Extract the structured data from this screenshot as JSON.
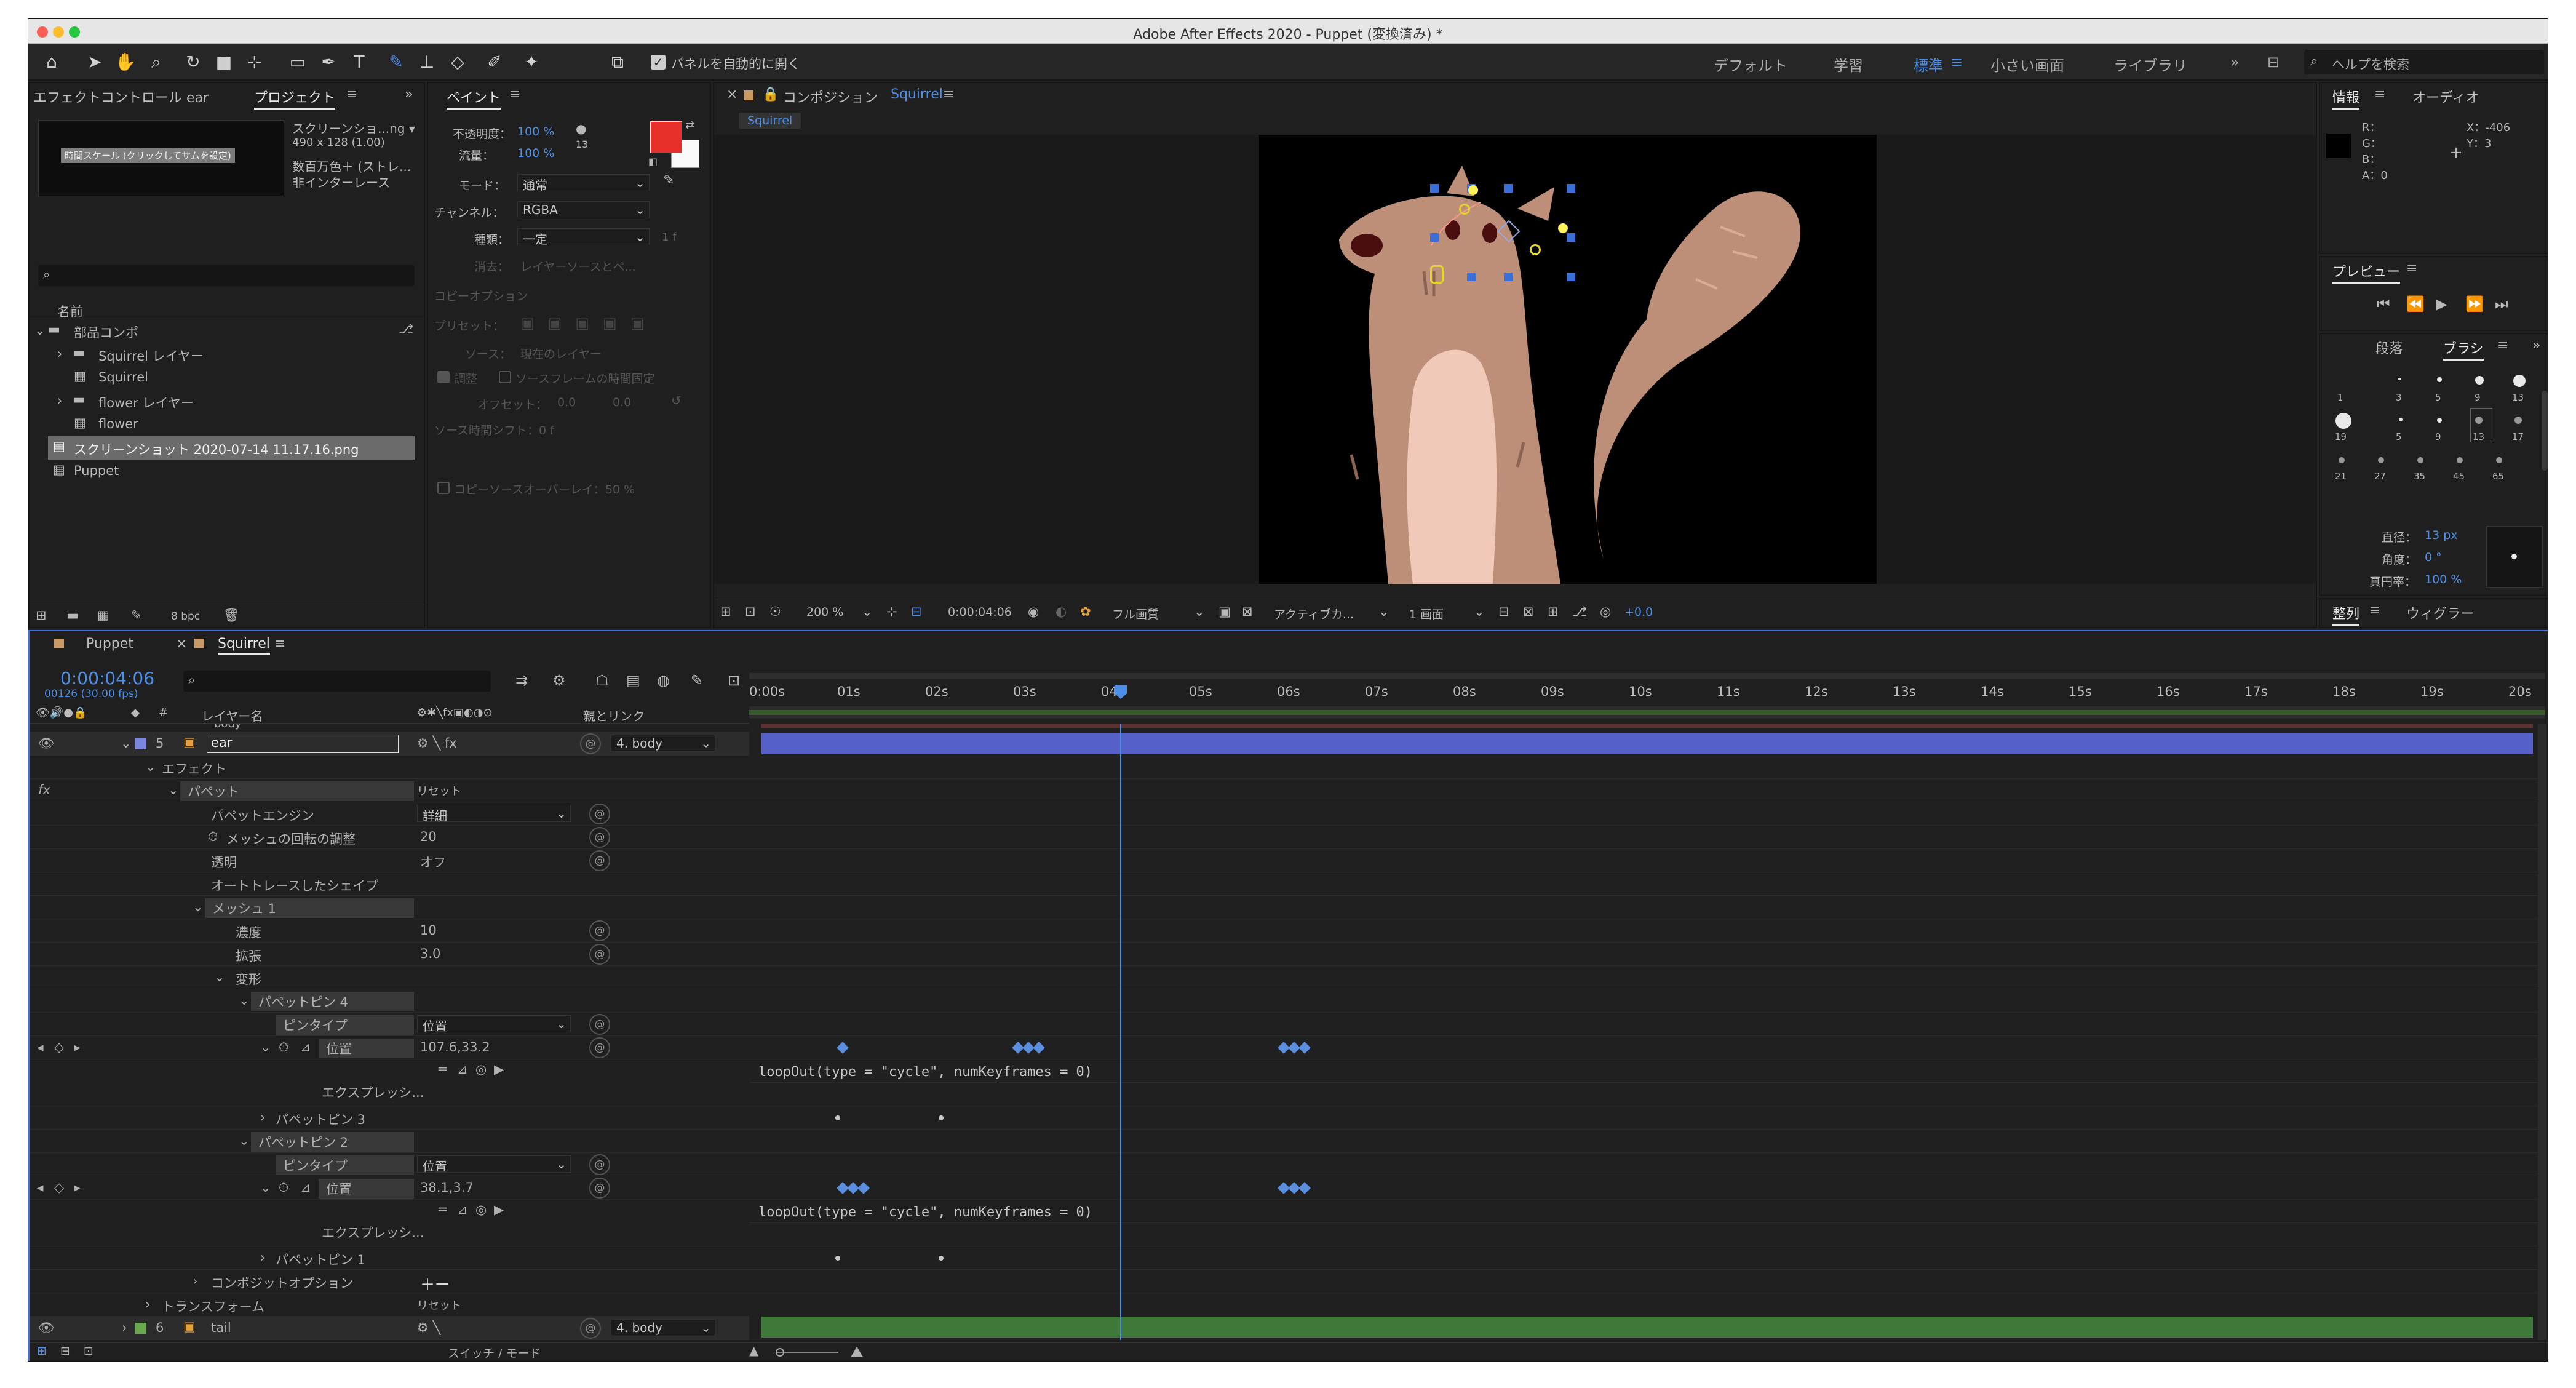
{
  "window": {
    "title": "Adobe After Effects 2020 - Puppet (変換済み) *"
  },
  "toolbar": {
    "auto_open": "パネルを自動的に開く",
    "ws_default": "デフォルト",
    "ws_learn": "学習",
    "ws_standard": "標準",
    "ws_small": "小さい画面",
    "ws_library": "ライブラリ",
    "search_placeholder": "ヘルプを検索",
    "more": "»"
  },
  "project": {
    "tab_effects": "エフェクトコントロール ear",
    "tab_project": "プロジェクト",
    "thumb_caption": "時間スケール (クリックしてサムを設定)",
    "file_name": "スクリーンショ...ng ▾",
    "file_dims": "490 x 128 (1.00)",
    "file_color": "数百万色＋ (ストレ...",
    "file_interlace": "非インターレース",
    "col_name": "名前",
    "items": [
      "部品コンポ",
      "Squirrel レイヤー",
      "Squirrel",
      "flower レイヤー",
      "flower",
      "スクリーンショット 2020-07-14 11.17.16.png",
      "Puppet"
    ],
    "bpc": "8 bpc"
  },
  "paint": {
    "title": "ペイント",
    "opacity_label": "不透明度：",
    "opacity": "100 %",
    "flow_label": "流量：",
    "flow": "100 %",
    "brush_size": "13",
    "mode_label": "モード：",
    "mode": "通常",
    "channel_label": "チャンネル：",
    "channel": "RGBA",
    "type_label": "種類：",
    "type": "一定",
    "erase_label": "消去：",
    "erase": "レイヤーソースとペ...",
    "clone_options": "コピーオプション",
    "preset_label": "プリセット：",
    "source_label": "ソース：",
    "source": "現在のレイヤー",
    "adjust": "調整",
    "lock_time": "ソースフレームの時間固定",
    "offset_label": "オフセット：",
    "offset_x": "0.0",
    "offset_y": "0.0",
    "time_shift": "ソース時間シフト：0 f",
    "overlay": "コピーソースオーバーレイ：50 %"
  },
  "comp": {
    "tab_label": "コンポジション",
    "comp_name": "Squirrel",
    "sub_tab": "Squirrel",
    "zoom": "200 %",
    "time": "0:00:04:06",
    "quality": "フル画質",
    "camera": "アクティブカ...",
    "views": "1 画面",
    "exposure": "+0.0"
  },
  "info": {
    "tab_info": "情報",
    "tab_audio": "オーディオ",
    "r": "R：",
    "g": "G：",
    "b": "B：",
    "a": "A：0",
    "x": "X：-406",
    "y": "Y：3"
  },
  "preview": {
    "title": "プレビュー"
  },
  "brush": {
    "tab_para": "段落",
    "tab_brush": "ブラシ",
    "sizes": [
      "1",
      "3",
      "5",
      "9",
      "13",
      "19",
      "5",
      "9",
      "13",
      "17",
      "21",
      "27",
      "35",
      "45",
      "65"
    ],
    "diameter_label": "直径：",
    "diameter": "13 px",
    "angle_label": "角度：",
    "angle": "0 °",
    "roundness_label": "真円率：",
    "roundness": "100 %"
  },
  "align": {
    "tab_align": "整列",
    "tab_wiggler": "ウィグラー"
  },
  "timeline": {
    "tab_puppet": "Puppet",
    "tab_squirrel": "Squirrel",
    "timecode": "0:00:04:06",
    "frames": "00126 (30.00 fps)",
    "col_layer": "レイヤー名",
    "col_parent": "親とリンク",
    "switch_mode": "スイッチ / モード",
    "ticks": [
      "0:00s",
      "01s",
      "02s",
      "03s",
      "04s",
      "05s",
      "06s",
      "07s",
      "08s",
      "09s",
      "10s",
      "11s",
      "12s",
      "13s",
      "14s",
      "15s",
      "16s",
      "17s",
      "18s",
      "19s",
      "20s"
    ],
    "layer_body": "body",
    "layer_ear_num": "5",
    "layer_ear": "ear",
    "parent_body": "4. body",
    "effects": "エフェクト",
    "fx": "fx",
    "puppet": "パペット",
    "reset": "リセット",
    "engine_label": "パペットエンジン",
    "engine": "詳細",
    "rotate_label": "メッシュの回転の調整",
    "rotate": "20",
    "transparency_label": "透明",
    "transparency": "オフ",
    "auto_shape": "オートトレースしたシェイプ",
    "mesh1": "メッシュ 1",
    "density_label": "濃度",
    "density": "10",
    "expansion_label": "拡張",
    "expansion": "3.0",
    "deform": "変形",
    "pin4": "パペットピン 4",
    "pin_type": "ピンタイプ",
    "pin_type_val": "位置",
    "position": "位置",
    "pos4": "107.6,33.2",
    "expression": "エクスプレッシ...",
    "expr_code": "loopOut(type = \"cycle\", numKeyframes = 0)",
    "pin3": "パペットピン 3",
    "pin2": "パペットピン 2",
    "pos2": "38.1,3.7",
    "pin1": "パペットピン 1",
    "composite": "コンポジットオプション",
    "plusminus": "＋ー",
    "transform": "トランスフォーム",
    "tail_num": "6",
    "tail": "tail"
  },
  "colors": {
    "accent": "#4d8fe6",
    "paint_fg": "#e8302a",
    "layer_bar_ear": "#5560c8",
    "layer_bar_tail": "#3f7a3a",
    "squirrel_body": "#bd8f79",
    "squirrel_belly": "#f0c9b8"
  }
}
